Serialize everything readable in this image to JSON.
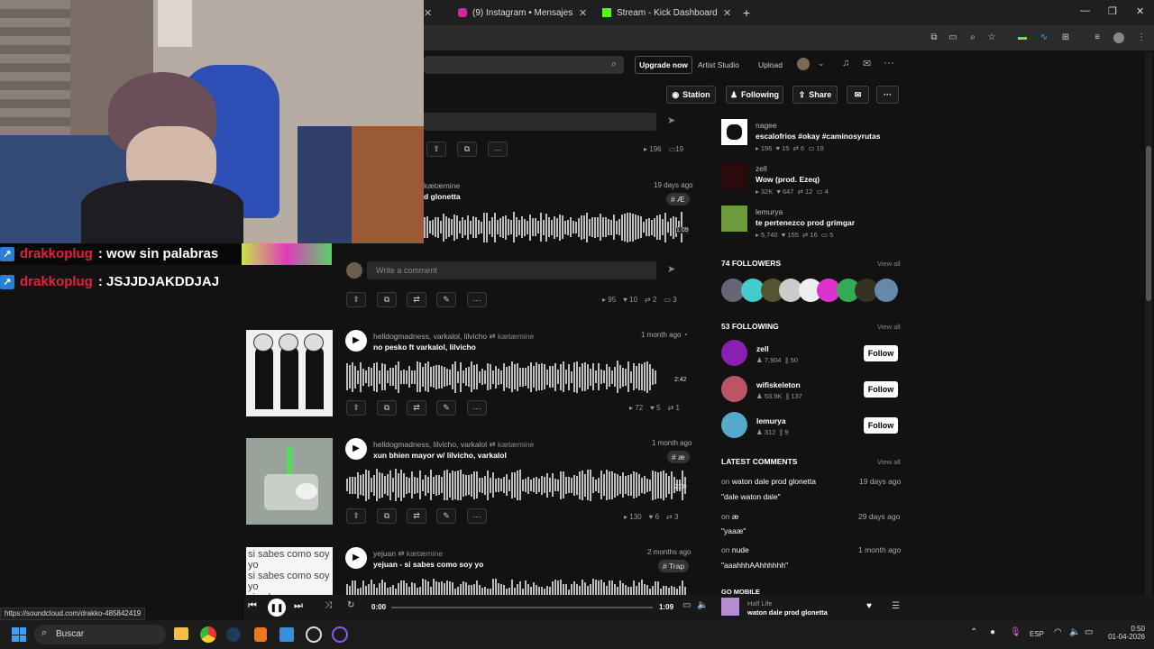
{
  "browser": {
    "tabs": [
      {
        "label": "(9) Instagram • Mensajes"
      },
      {
        "label": "Stream - Kick Dashboard"
      }
    ]
  },
  "header": {
    "upgrade": "Upgrade now",
    "artist_studio": "Artist Studio",
    "upload": "Upload"
  },
  "profile_actions": {
    "station": "Station",
    "following": "Following",
    "share": "Share"
  },
  "tracks": [
    {
      "artist": "kætæmine",
      "title": "d glonetta",
      "time": "19 days ago",
      "tag": "# Æ",
      "duration": "1:09",
      "plays": "196",
      "comments": "19",
      "comment_placeholder": "Write a comment",
      "stats": {
        "plays": "95",
        "likes": "10",
        "reposts": "2",
        "comments": "3"
      }
    },
    {
      "artist": "helldogmadness, varkalol, lilvicho",
      "repost": "kætæmine",
      "title": "no pesko ft varkalol, lilvicho",
      "time": "1 month ago",
      "duration": "2:42",
      "stats": {
        "plays": "72",
        "likes": "5",
        "reposts": "1"
      }
    },
    {
      "artist": "helldogmadness, lilvicho, varkalol",
      "repost": "kætæmine",
      "title": "xun bhien mayor w/ lilvicho, varkalol",
      "time": "1 month ago",
      "tag": "# æ",
      "duration": "2:00",
      "stats": {
        "plays": "130",
        "likes": "6",
        "reposts": "3"
      }
    },
    {
      "artist": "yejuan",
      "repost": "kætæmine",
      "title": "yejuan - si sabes como soy yo",
      "time": "2 months ago",
      "tag": "# Trap",
      "art_text": "si sabes como soy yo"
    }
  ],
  "likes": [
    {
      "artist": "nagee",
      "title": "escalofrios #okay #caminosyrutas",
      "plays": "196",
      "likes": "15",
      "reposts": "6",
      "comments": "19"
    },
    {
      "artist": "zell",
      "title": "Wow (prod. Ezeq)",
      "plays": "32K",
      "likes": "647",
      "reposts": "12",
      "comments": "4"
    },
    {
      "artist": "lemurya",
      "title": "te pertenezco prod grimgar",
      "plays": "5,740",
      "likes": "155",
      "reposts": "16",
      "comments": "5"
    }
  ],
  "followers": {
    "title": "74 FOLLOWERS",
    "view_all": "View all"
  },
  "following_list": {
    "title": "53 FOLLOWING",
    "view_all": "View all",
    "follow_label": "Follow",
    "users": [
      {
        "name": "zell",
        "followers": "7,904",
        "tracks": "50"
      },
      {
        "name": "wifiskeleton",
        "followers": "53.9K",
        "tracks": "137"
      },
      {
        "name": "lemurya",
        "followers": "312",
        "tracks": "9"
      }
    ]
  },
  "latest_comments": {
    "title": "LATEST COMMENTS",
    "view_all": "View all",
    "items": [
      {
        "on": "on",
        "track": "waton dale prod glonetta",
        "time": "19 days ago",
        "text": "\"dale waton dale\""
      },
      {
        "on": "on",
        "track": "æ",
        "time": "29 days ago",
        "text": "\"yaaæ\""
      },
      {
        "on": "on",
        "track": "nude",
        "time": "1 month ago",
        "text": "\"aaahhhAAhhhhhh\""
      }
    ]
  },
  "go_mobile": "GO MOBILE",
  "player": {
    "current": "0:00",
    "duration": "1:09",
    "artist": "Half Life",
    "title": "waton dale prod glonetta"
  },
  "chat": [
    {
      "user": "drakkoplug",
      "message": ": wow sin palabras"
    },
    {
      "user": "drakkoplug",
      "message": ": JSJJDJAKDDJAJ"
    }
  ],
  "status_url": "https://soundcloud.com/drakko-485842419",
  "taskbar": {
    "search": "Buscar",
    "lang": "ESP",
    "time": "0:50",
    "date": "01-04-2026"
  }
}
